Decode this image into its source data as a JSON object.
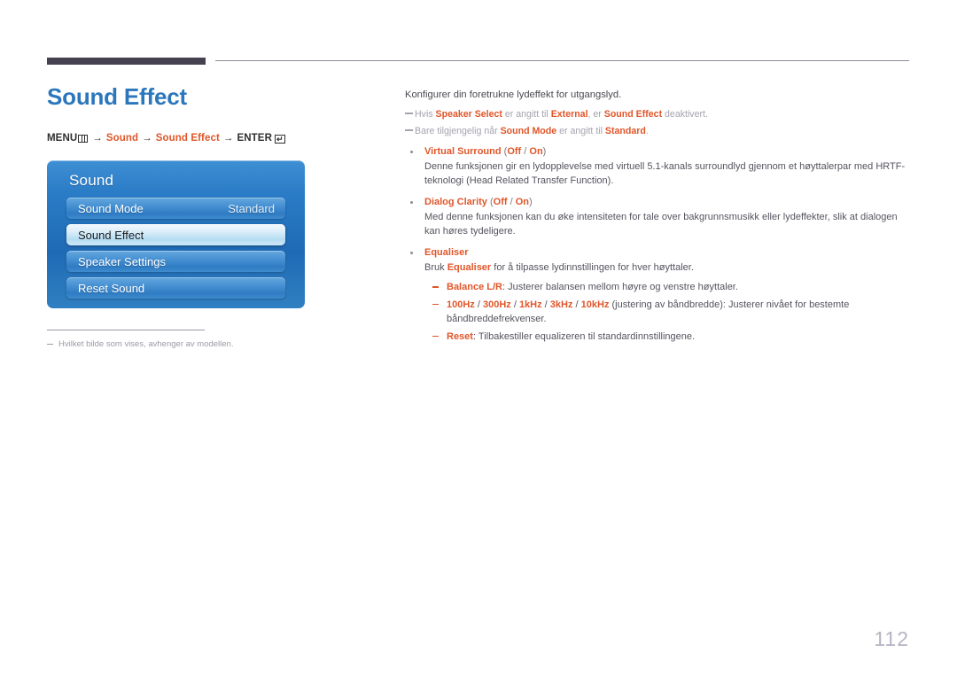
{
  "page": {
    "title": "Sound Effect",
    "number": "112",
    "accent_blue": "#2b77bc",
    "accent_orange": "#e0562a",
    "rule_dark": "#46414f"
  },
  "menu_path": {
    "menu_label": "MENU",
    "menu_icon": "menu-bars-icon",
    "arrow": "→",
    "step1": "Sound",
    "step2": "Sound Effect",
    "enter_label": "ENTER",
    "enter_icon": "enter-return-icon",
    "enter_glyph": "↵"
  },
  "osd": {
    "title": "Sound",
    "items": [
      {
        "label": "Sound Mode",
        "value": "Standard",
        "selected": false
      },
      {
        "label": "Sound Effect",
        "value": "",
        "selected": true
      },
      {
        "label": "Speaker Settings",
        "value": "",
        "selected": false
      },
      {
        "label": "Reset Sound",
        "value": "",
        "selected": false
      }
    ]
  },
  "left_note": {
    "text": "Hvilket bilde som vises, avhenger av modellen."
  },
  "content": {
    "intro": "Konfigurer din foretrukne lydeffekt for utgangslyd.",
    "notes": [
      {
        "parts": [
          {
            "t": "Hvis ",
            "style": "dim"
          },
          {
            "t": "Speaker Select",
            "style": "strong"
          },
          {
            "t": " er angitt til ",
            "style": "dim"
          },
          {
            "t": "External",
            "style": "strong"
          },
          {
            "t": ", er ",
            "style": "dim"
          },
          {
            "t": "Sound Effect",
            "style": "strong"
          },
          {
            "t": " deaktivert.",
            "style": "dim"
          }
        ]
      },
      {
        "parts": [
          {
            "t": "Bare tilgjengelig når ",
            "style": "dim"
          },
          {
            "t": "Sound Mode",
            "style": "strong"
          },
          {
            "t": " er angitt til ",
            "style": "dim"
          },
          {
            "t": "Standard",
            "style": "strong"
          },
          {
            "t": ".",
            "style": "dim"
          }
        ]
      }
    ],
    "bullets": [
      {
        "head": "Virtual Surround",
        "head_suffix_open": " (",
        "head_options": [
          "Off",
          "On"
        ],
        "head_separator": " / ",
        "head_suffix_close": ")",
        "desc_parts": [
          {
            "t": "Denne funksjonen gir en lydopplevelse med virtuell 5.1-kanals surroundlyd gjennom et høyttalerpar med HRTF-teknologi (Head Related Transfer Function).",
            "style": "plain"
          }
        ],
        "sublist": []
      },
      {
        "head": "Dialog Clarity",
        "head_suffix_open": " (",
        "head_options": [
          "Off",
          "On"
        ],
        "head_separator": " / ",
        "head_suffix_close": ")",
        "desc_parts": [
          {
            "t": "Med denne funksjonen kan du øke intensiteten for tale over bakgrunnsmusikk eller lydeffekter, slik at dialogen kan høres tydeligere.",
            "style": "plain"
          }
        ],
        "sublist": []
      },
      {
        "head": "Equaliser",
        "head_suffix_open": "",
        "head_options": [],
        "head_separator": "",
        "head_suffix_close": "",
        "desc_parts": [
          {
            "t": "Bruk ",
            "style": "plain"
          },
          {
            "t": "Equaliser",
            "style": "strong"
          },
          {
            "t": " for å tilpasse lydinnstillingen for hver høyttaler.",
            "style": "plain"
          }
        ],
        "sublist": [
          {
            "parts": [
              {
                "t": "Balance L/R",
                "style": "strong"
              },
              {
                "t": ": Justerer balansen mellom høyre og venstre høyttaler.",
                "style": "plain"
              }
            ]
          },
          {
            "parts": [
              {
                "t": "100Hz",
                "style": "strong"
              },
              {
                "t": " / ",
                "style": "plain"
              },
              {
                "t": "300Hz",
                "style": "strong"
              },
              {
                "t": " / ",
                "style": "plain"
              },
              {
                "t": "1kHz",
                "style": "strong"
              },
              {
                "t": " / ",
                "style": "plain"
              },
              {
                "t": "3kHz",
                "style": "strong"
              },
              {
                "t": " / ",
                "style": "plain"
              },
              {
                "t": "10kHz",
                "style": "strong"
              },
              {
                "t": " (justering av båndbredde): Justerer nivået for bestemte båndbreddefrekvenser.",
                "style": "plain"
              }
            ]
          },
          {
            "parts": [
              {
                "t": "Reset",
                "style": "strong"
              },
              {
                "t": ": Tilbakestiller equalizeren til standardinnstillingene.",
                "style": "plain"
              }
            ]
          }
        ]
      }
    ]
  }
}
